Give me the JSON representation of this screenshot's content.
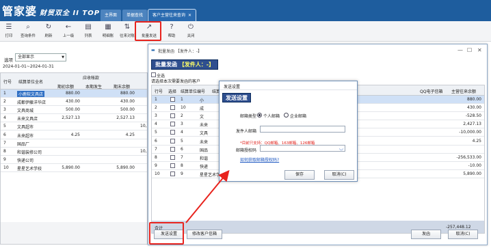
{
  "app": {
    "logo": "管家婆",
    "logo_sub": "财贸双全 II TOP+",
    "tabs": [
      {
        "label": "主界面"
      },
      {
        "label": "单据查找"
      },
      {
        "label": "客户主营往来查询",
        "close": "✕"
      }
    ]
  },
  "toolbar": {
    "items": [
      {
        "icon": "☰",
        "label": "打印"
      },
      {
        "icon": "⌕",
        "label": "查询条件"
      },
      {
        "icon": "↻",
        "label": "刷新"
      },
      {
        "icon": "←",
        "label": "上一级"
      },
      {
        "icon": "▤",
        "label": "列表"
      },
      {
        "icon": "▦",
        "label": "明细账"
      },
      {
        "icon": "⇅",
        "label": "往来对账"
      },
      {
        "icon": "↗",
        "label": "批量发送"
      },
      {
        "icon": "?",
        "label": "帮助"
      },
      {
        "icon": "⏻",
        "label": "关闭"
      }
    ]
  },
  "filter": {
    "label": "选项",
    "value": "全部显示",
    "date_range": "2024-01-01~2024-01-31"
  },
  "main_table": {
    "headers": {
      "row_no": "行号",
      "unit_name": "结算单位全名",
      "receivable_group": "应收帐款",
      "opening": "期初余额",
      "increase": "本期发生",
      "closing": "期末余额"
    },
    "rows": [
      {
        "no": "1",
        "name": "小鹿软文具店",
        "opening": "880.00",
        "closing": "880.00",
        "extra": ""
      },
      {
        "no": "2",
        "name": "成都伊藤洋华店",
        "opening": "430.00",
        "closing": "430.00",
        "extra": ""
      },
      {
        "no": "3",
        "name": "文具商城",
        "opening": "500.00",
        "closing": "500.00",
        "extra": ""
      },
      {
        "no": "4",
        "name": "未来文具店",
        "opening": "2,527.13",
        "closing": "2,527.13",
        "extra": ""
      },
      {
        "no": "5",
        "name": "文具超市",
        "opening": "",
        "closing": "",
        "extra": "10,"
      },
      {
        "no": "6",
        "name": "未来超市",
        "opening": "4.25",
        "closing": "4.25",
        "extra": ""
      },
      {
        "no": "7",
        "name": "国品厂",
        "opening": "",
        "closing": "",
        "extra": ""
      },
      {
        "no": "8",
        "name": "和谐装修公司",
        "opening": "",
        "closing": "",
        "extra": "10,"
      },
      {
        "no": "9",
        "name": "快递公司",
        "opening": "",
        "closing": "",
        "extra": ""
      },
      {
        "no": "10",
        "name": "星星艺术学校",
        "opening": "5,890.00",
        "closing": "5,890.00",
        "extra": ""
      }
    ]
  },
  "batch_dialog": {
    "title": "批量发函 【发件人：-】",
    "banner_prefix": "批量发函",
    "banner_sender": "【发件人：-】",
    "select_all": "全选",
    "hint": "请选择本次需要发函的客户",
    "headers": {
      "row_no": "行号",
      "select": "选择",
      "unit_no": "结算单位编号",
      "unit_name": "结算单位名称",
      "email": "QQ电子信箱",
      "balance": "主营往来余额"
    },
    "rows": [
      {
        "no": "1",
        "code": "1",
        "name": "小",
        "balance": "880.00"
      },
      {
        "no": "2",
        "code": "10",
        "name": "成",
        "balance": "430.00"
      },
      {
        "no": "3",
        "code": "2",
        "name": "文",
        "balance": "-528.50"
      },
      {
        "no": "4",
        "code": "3",
        "name": "未来",
        "balance": "2,427.13"
      },
      {
        "no": "5",
        "code": "4",
        "name": "文具",
        "balance": "-10,000.00"
      },
      {
        "no": "6",
        "code": "5",
        "name": "未来",
        "balance": "4.25"
      },
      {
        "no": "7",
        "code": "6",
        "name": "国品",
        "balance": ""
      },
      {
        "no": "8",
        "code": "7",
        "name": "和谐",
        "balance": "-256,533.00"
      },
      {
        "no": "9",
        "code": "8",
        "name": "快递",
        "balance": "-10.00"
      },
      {
        "no": "10",
        "code": "9",
        "name": "星星艺术学校",
        "balance": "5,890.00"
      }
    ],
    "sum_label": "合计",
    "sum_value": "-257,448.12",
    "send_settings_btn": "发送设置",
    "edit_email_btn": "修改客户信箱",
    "send_btn": "发函",
    "cancel_btn": "取消(C)"
  },
  "send_settings": {
    "title": "发送设置",
    "banner": "发送设置",
    "mail_type_label": "邮箱类型",
    "personal": "个人邮箱",
    "enterprise": "企业邮箱",
    "sender_label": "发件人邮箱",
    "sender_value": "",
    "note": "*目前只支持：QQ邮箱、163邮箱、126邮箱",
    "auth_label": "邮箱授权码",
    "auth_value": "",
    "link": "如何获取邮箱授权码?",
    "save": "保存",
    "cancel": "取消(C)"
  },
  "colors": {
    "header_bg": "#1e5d9e",
    "banner_bg": "#2f4f8f",
    "annotation_red": "#e8231d",
    "note_red": "#e0201a"
  }
}
